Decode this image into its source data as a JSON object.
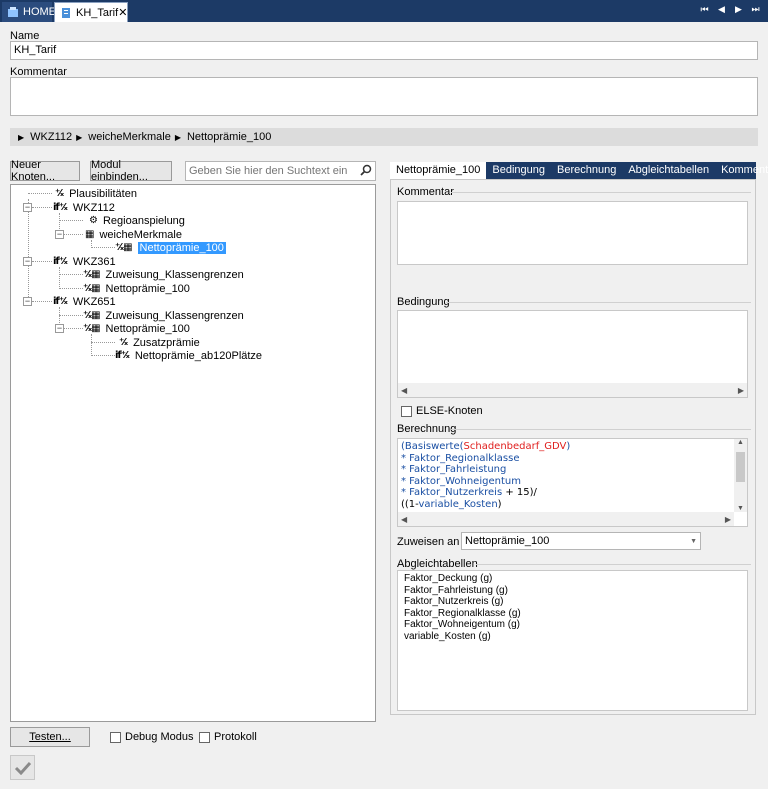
{
  "tabs": {
    "home": "HOME",
    "active": "KH_Tarif",
    "close": "✕"
  },
  "nav": [
    "⏮",
    "◀",
    "▶",
    "⏭"
  ],
  "form": {
    "name_label": "Name",
    "name_value": "KH_Tarif",
    "comment_label": "Kommentar",
    "comment_value": ""
  },
  "breadcrumb": [
    "WKZ112",
    "weicheMerkmale",
    "Nettoprämie_100"
  ],
  "toolbar": {
    "new_node": "Neuer Knoten...",
    "embed_module": "Modul einbinden...",
    "search_placeholder": "Geben Sie hier den Suchtext ein"
  },
  "tree": {
    "n1": "Plausibilitäten",
    "n2": "WKZ112",
    "n3": "Regioanspielung",
    "n4": "weicheMerkmale",
    "n5": "Nettoprämie_100",
    "n6": "WKZ361",
    "n7": "Zuweisung_Klassengrenzen",
    "n8": "Nettoprämie_100",
    "n9": "WKZ651",
    "n10": "Zuweisung_Klassengrenzen",
    "n11": "Nettoprämie_100",
    "n12": "Zusatzprämie",
    "n13": "Nettoprämie_ab120Plätze"
  },
  "right_tabs": [
    "Nettoprämie_100",
    "Bedingung",
    "Berechnung",
    "Abgleichtabellen",
    "Kommentar"
  ],
  "panel": {
    "comment_title": "Kommentar",
    "condition_title": "Bedingung",
    "else_node": "ELSE-Knoten",
    "calc_title": "Berechnung",
    "assign_label": "Zuweisen an",
    "assign_value": "Nettoprämie_100",
    "tables_title": "Abgleichtabellen"
  },
  "calc": {
    "l1a": "(Basiswerte(",
    "l1b": "Schadenbedarf_GDV",
    "l1c": ")",
    "l2": "* Faktor_Regionalklasse",
    "l3": "* Faktor_Fahrleistung",
    "l4": "* Faktor_Wohneigentum",
    "l5a": "* Faktor_Nutzerkreis",
    "l5b": " + 15)/",
    "l6a": "((1-",
    "l6b": "variable_Kosten",
    "l6c": ")"
  },
  "tables": [
    "Faktor_Deckung (g)",
    "Faktor_Fahrleistung (g)",
    "Faktor_Nutzerkreis (g)",
    "Faktor_Regionalklasse (g)",
    "Faktor_Wohneigentum (g)",
    "variable_Kosten (g)"
  ],
  "bottom": {
    "test_button": "Testen...",
    "debug_mode": "Debug Modus",
    "protocol": "Protokoll"
  },
  "colors": {
    "tabbar": "#1c3a66",
    "selection": "#3399ff",
    "code_blue": "#1a4fa3",
    "code_red": "#e0201f"
  }
}
